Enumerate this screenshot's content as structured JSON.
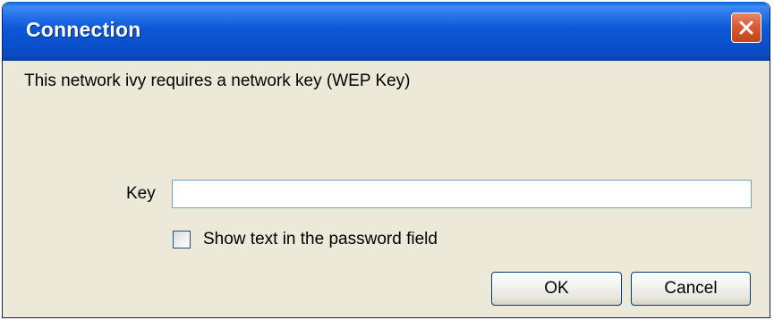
{
  "window": {
    "title": "Connection",
    "close_icon": "close-icon"
  },
  "message": "This network ivy requires a network key (WEP Key)",
  "key_field": {
    "label": "Key",
    "value": "",
    "placeholder": ""
  },
  "show_text_checkbox": {
    "label": "Show text in the password field",
    "checked": false
  },
  "buttons": {
    "ok_label": "OK",
    "cancel_label": "Cancel"
  },
  "colors": {
    "titlebar": "#0a4fcb",
    "close_button": "#d95a34",
    "dialog_background": "#ece9d8"
  }
}
